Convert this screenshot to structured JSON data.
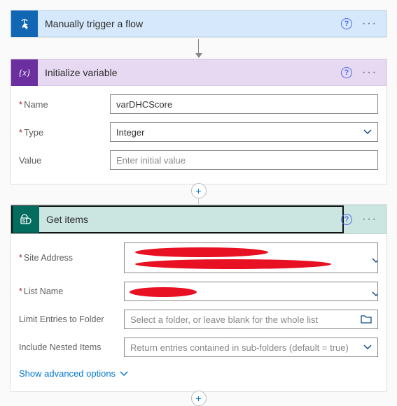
{
  "trigger": {
    "title": "Manually trigger a flow"
  },
  "initVar": {
    "title": "Initialize variable",
    "nameLabel": "Name",
    "nameValue": "varDHCScore",
    "typeLabel": "Type",
    "typeValue": "Integer",
    "valueLabel": "Value",
    "valuePlaceholder": "Enter initial value"
  },
  "getItems": {
    "title": "Get items",
    "siteLabel": "Site Address",
    "listLabel": "List Name",
    "limitLabel": "Limit Entries to Folder",
    "limitPlaceholder": "Select a folder, or leave blank for the whole list",
    "nestedLabel": "Include Nested Items",
    "nestedPlaceholder": "Return entries contained in sub-folders (default = true)",
    "advancedLink": "Show advanced options"
  },
  "icons": {
    "plus": "+",
    "help": "?"
  }
}
